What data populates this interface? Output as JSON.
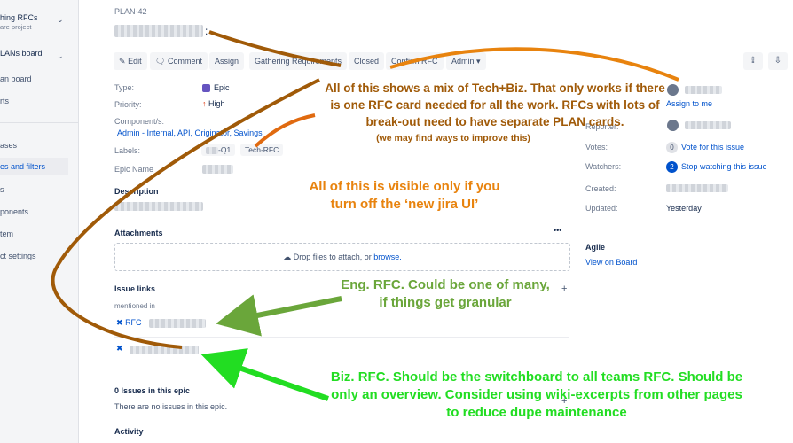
{
  "sidebar": {
    "project_name": "hing RFCs",
    "project_type": "are project",
    "board_name": "LANs board",
    "items": [
      {
        "label": "an board"
      },
      {
        "label": "rts"
      },
      {
        "label": "ases"
      },
      {
        "label": "es and filters"
      },
      {
        "label": "s"
      },
      {
        "label": "ponents"
      },
      {
        "label": "tem"
      },
      {
        "label": "ct settings"
      }
    ]
  },
  "issue": {
    "key": "PLAN-42",
    "title_suffix": ":",
    "toolbar": {
      "edit": "Edit",
      "comment": "Comment",
      "assign": "Assign",
      "gathering": "Gathering Requirements",
      "closed": "Closed",
      "confirm": "Confirm RFC",
      "admin": "Admin"
    },
    "details": {
      "type_label": "Type:",
      "type_value": "Epic",
      "priority_label": "Priority:",
      "priority_value": "High",
      "components_label": "Component/s:",
      "components_value": "Admin - Internal, API, Originator, Savings",
      "labels_label": "Labels:",
      "label1": "-Q1",
      "label2": "Tech-RFC",
      "epic_name_label": "Epic Name"
    },
    "description_heading": "Description",
    "attachments_heading": "Attachments",
    "attachments_more": "•••",
    "dropzone_text": "Drop files to attach, or",
    "dropzone_link": "browse.",
    "issue_links_heading": "Issue links",
    "issue_links_add": "+",
    "mentioned_in": "mentioned in",
    "rfc_link_prefix": "RFC",
    "epic_issues_heading": "0 Issues in this epic",
    "epic_issues_empty": "There are no issues in this epic.",
    "activity_heading": "Activity",
    "plus_marker": "+"
  },
  "people": {
    "assign_to_me": "Assign to me",
    "reporter_label": "Reporter:",
    "votes_label": "Votes:",
    "votes_count": "0",
    "vote_link": "Vote for this issue",
    "watchers_label": "Watchers:",
    "watchers_count": "2",
    "watch_link": "Stop watching this issue",
    "created_label": "Created:",
    "updated_label": "Updated:",
    "updated_value": "Yesterday"
  },
  "agile": {
    "heading": "Agile",
    "link": "View on Board"
  },
  "annotations": {
    "techbiz": "All of this shows a mix of Tech+Biz. That only works if there is one RFC card needed for all the work.  RFCs with lots of break-out need to have separate PLAN cards.",
    "improve": "(we may find ways to improve this)",
    "visible": "All of this is visible only if you turn off the ‘new jira UI’",
    "eng": "Eng. RFC.  Could be one of many, if things get granular",
    "biz": "Biz. RFC.  Should be the switchboard to all teams RFC. Should be only an overview.  Consider using wiki-excerpts from other pages to reduce dupe maintenance"
  },
  "colors": {
    "brown": "#a05a08",
    "orange": "#e06a10",
    "amber": "#e8830e",
    "olive": "#6aa63a",
    "green": "#22dd22",
    "link": "#0052cc"
  }
}
